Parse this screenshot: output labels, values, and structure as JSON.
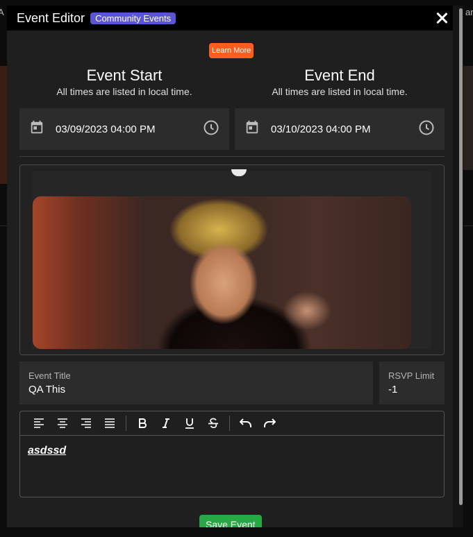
{
  "modal": {
    "title": "Event Editor",
    "badge": "Community Events",
    "learn_more": "Learn More"
  },
  "event_start": {
    "heading": "Event Start",
    "note": "All times are listed in local time.",
    "value": "03/09/2023 04:00 PM"
  },
  "event_end": {
    "heading": "Event End",
    "note": "All times are listed in local time.",
    "value": "03/10/2023 04:00 PM"
  },
  "fields": {
    "title_label": "Event Title",
    "title_value": "QA This",
    "rsvp_label": "RSVP Limit",
    "rsvp_value": "-1"
  },
  "editor": {
    "content": "asdssd"
  },
  "save_label": "Save Event",
  "icons": [
    "close-icon",
    "calendar-icon",
    "clock-icon",
    "align-left-icon",
    "align-center-icon",
    "align-right-icon",
    "align-justify-icon",
    "bold-icon",
    "italic-icon",
    "underline-icon",
    "strikethrough-icon",
    "undo-icon",
    "redo-icon"
  ],
  "colors": {
    "badge": "#5b55d6",
    "learn_more": "#ff5d1f",
    "save": "#27a844"
  }
}
